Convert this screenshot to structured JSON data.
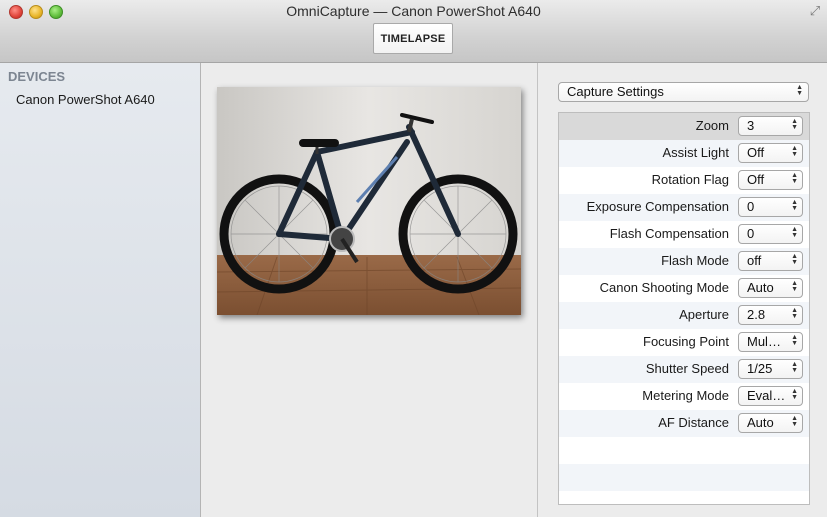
{
  "window": {
    "title": "OmniCapture — Canon PowerShot A640",
    "toolbar_button": "TIMELAPSE"
  },
  "sidebar": {
    "heading": "DEVICES",
    "items": [
      {
        "label": "Canon PowerShot A640"
      }
    ]
  },
  "preview": {
    "colors": {
      "wall": "#e4e2df",
      "floor": "#8a5a3a",
      "frame": "#1f2a38",
      "accent": "#5d7fb0"
    }
  },
  "settings": {
    "section_popup": "Capture Settings",
    "rows": [
      {
        "label": "Zoom",
        "value": "3"
      },
      {
        "label": "Assist Light",
        "value": "Off"
      },
      {
        "label": "Rotation Flag",
        "value": "Off"
      },
      {
        "label": "Exposure Compensation",
        "value": "0"
      },
      {
        "label": "Flash Compensation",
        "value": "0"
      },
      {
        "label": "Flash Mode",
        "value": "off"
      },
      {
        "label": "Canon Shooting Mode",
        "value": "Auto"
      },
      {
        "label": "Aperture",
        "value": "2.8"
      },
      {
        "label": "Focusing Point",
        "value": "Mul…"
      },
      {
        "label": "Shutter Speed",
        "value": "1/25"
      },
      {
        "label": "Metering Mode",
        "value": "Eval…"
      },
      {
        "label": "AF Distance",
        "value": "Auto"
      }
    ]
  }
}
